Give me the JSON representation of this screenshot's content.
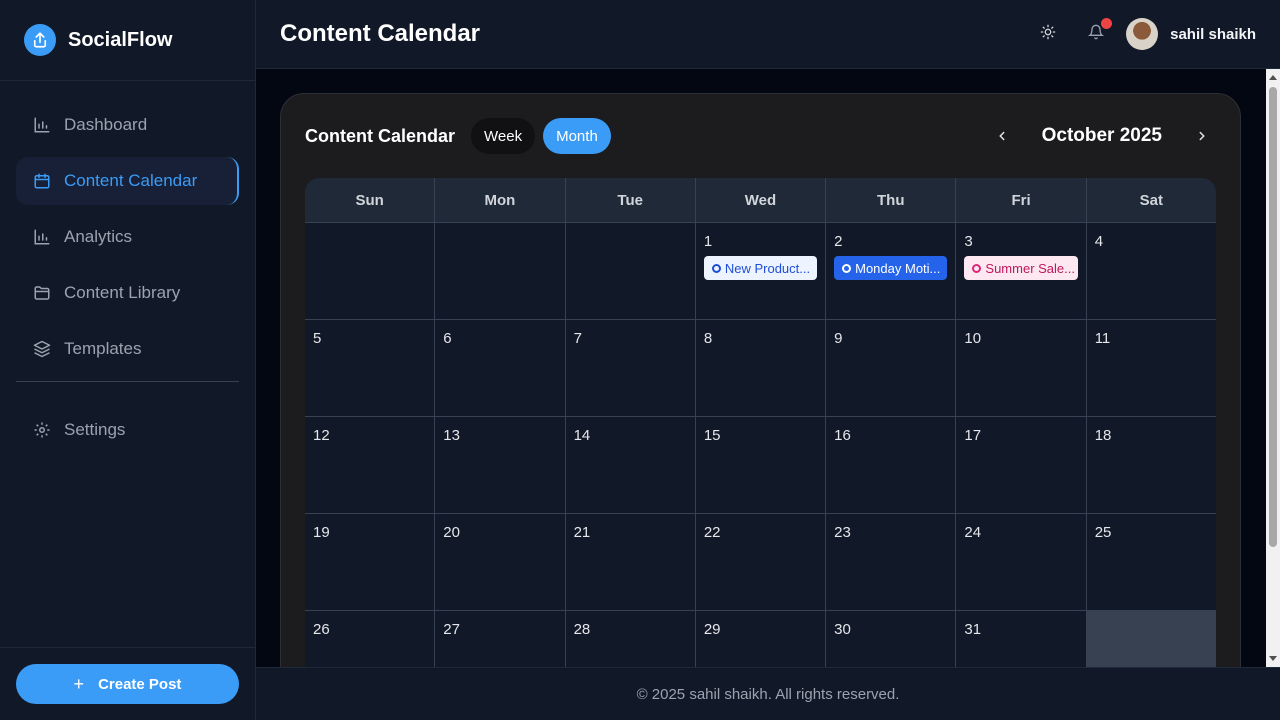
{
  "app": {
    "name": "SocialFlow",
    "logo_icon": "upload-icon",
    "accent": "#3b9cf7"
  },
  "sidebar": {
    "items": [
      {
        "label": "Dashboard",
        "icon": "bar-chart-icon",
        "active": false
      },
      {
        "label": "Content Calendar",
        "icon": "calendar-icon",
        "active": true
      },
      {
        "label": "Analytics",
        "icon": "bar-chart-icon",
        "active": false
      },
      {
        "label": "Content Library",
        "icon": "folder-icon",
        "active": false
      },
      {
        "label": "Templates",
        "icon": "layers-icon",
        "active": false
      }
    ],
    "settings": {
      "label": "Settings",
      "icon": "gear-icon"
    },
    "create_button": {
      "label": "Create Post",
      "icon": "plus-icon"
    }
  },
  "header": {
    "title": "Content Calendar",
    "user_name": "sahil shaikh",
    "theme_icon": "sun-icon",
    "notification_icon": "bell-icon"
  },
  "calendar": {
    "title": "Content Calendar",
    "views": [
      {
        "label": "Week",
        "active": false
      },
      {
        "label": "Month",
        "active": true
      }
    ],
    "month_label": "October 2025",
    "prev_icon": "chevron-left-icon",
    "next_icon": "chevron-right-icon",
    "days_of_week": [
      "Sun",
      "Mon",
      "Tue",
      "Wed",
      "Thu",
      "Fri",
      "Sat"
    ],
    "weeks": [
      [
        {
          "day": ""
        },
        {
          "day": ""
        },
        {
          "day": ""
        },
        {
          "day": "1",
          "event": {
            "label": "New Product...",
            "platform_icon": "facebook-icon",
            "bg": "#eef4ff",
            "fg": "#1d4ed8"
          }
        },
        {
          "day": "2",
          "event": {
            "label": "Monday Moti...",
            "platform_icon": "linkedin-icon",
            "bg": "#2563eb",
            "fg": "#ffffff"
          }
        },
        {
          "day": "3",
          "event": {
            "label": "Summer Sale...",
            "platform_icon": "instagram-icon",
            "bg": "#fde7f1",
            "fg": "#be185d"
          }
        },
        {
          "day": "4"
        }
      ],
      [
        {
          "day": "5"
        },
        {
          "day": "6"
        },
        {
          "day": "7"
        },
        {
          "day": "8"
        },
        {
          "day": "9"
        },
        {
          "day": "10"
        },
        {
          "day": "11"
        }
      ],
      [
        {
          "day": "12"
        },
        {
          "day": "13"
        },
        {
          "day": "14"
        },
        {
          "day": "15"
        },
        {
          "day": "16"
        },
        {
          "day": "17"
        },
        {
          "day": "18"
        }
      ],
      [
        {
          "day": "19"
        },
        {
          "day": "20"
        },
        {
          "day": "21"
        },
        {
          "day": "22"
        },
        {
          "day": "23"
        },
        {
          "day": "24"
        },
        {
          "day": "25"
        }
      ],
      [
        {
          "day": "26"
        },
        {
          "day": "27"
        },
        {
          "day": "28"
        },
        {
          "day": "29"
        },
        {
          "day": "30"
        },
        {
          "day": "31"
        },
        {
          "day": "",
          "filler": true
        }
      ]
    ]
  },
  "footer": {
    "text": "© 2025 sahil shaikh. All rights reserved."
  }
}
